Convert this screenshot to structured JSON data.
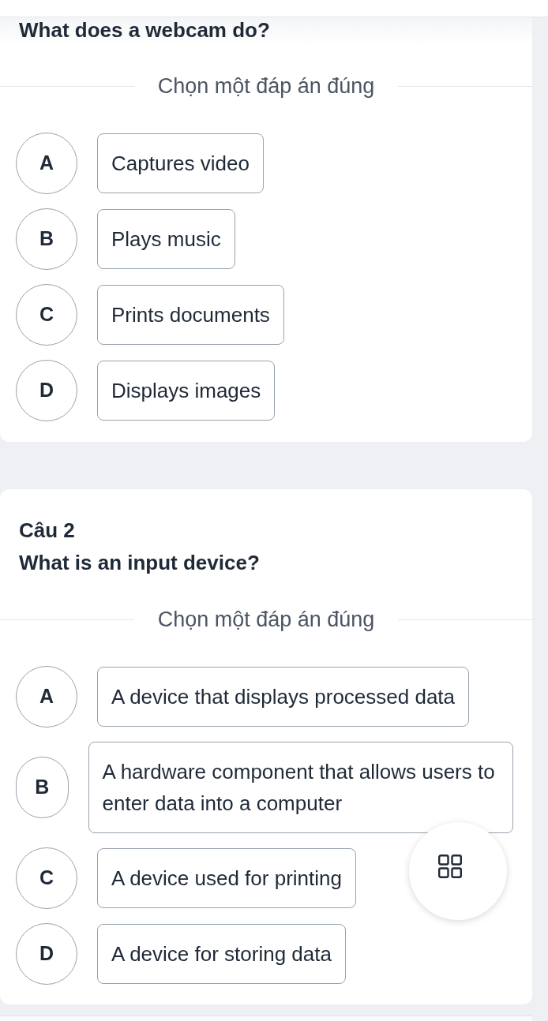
{
  "questions": [
    {
      "title": "What does a webcam do?",
      "instruction": "Chọn một đáp án đúng",
      "options": [
        {
          "letter": "A",
          "text": "Captures video",
          "selected": false
        },
        {
          "letter": "B",
          "text": "Plays music",
          "selected": false
        },
        {
          "letter": "C",
          "text": "Prints documents",
          "selected": false
        },
        {
          "letter": "D",
          "text": "Displays images",
          "selected": false
        }
      ]
    },
    {
      "number": "Câu 2",
      "title": "What is an input device?",
      "instruction": "Chọn một đáp án đúng",
      "options": [
        {
          "letter": "A",
          "text": "A device that displays processed data",
          "selected": false
        },
        {
          "letter": "B",
          "text": "A hardware component that allows users to enter data into a computer",
          "selected": false
        },
        {
          "letter": "C",
          "text": "A device used for printing",
          "selected": false
        },
        {
          "letter": "D",
          "text": "A device for storing data",
          "selected": false
        }
      ]
    }
  ]
}
